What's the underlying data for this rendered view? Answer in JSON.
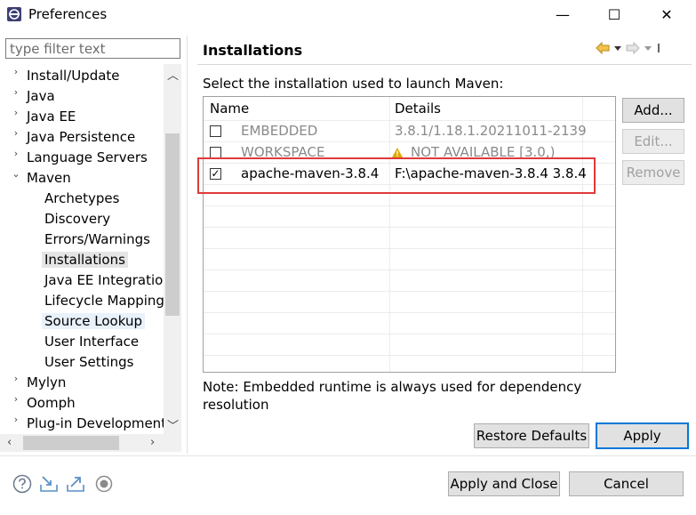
{
  "window": {
    "title": "Preferences",
    "min_glyph": "—",
    "max_glyph": "☐",
    "close_glyph": "✕"
  },
  "filter": {
    "placeholder": "type filter text"
  },
  "tree": {
    "items": [
      {
        "label": "Install/Update",
        "level": 0,
        "expander": "›"
      },
      {
        "label": "Java",
        "level": 0,
        "expander": "›"
      },
      {
        "label": "Java EE",
        "level": 0,
        "expander": "›"
      },
      {
        "label": "Java Persistence",
        "level": 0,
        "expander": "›"
      },
      {
        "label": "Language Servers",
        "level": 0,
        "expander": "›"
      },
      {
        "label": "Maven",
        "level": 0,
        "expander": "⌄"
      },
      {
        "label": "Archetypes",
        "level": 1
      },
      {
        "label": "Discovery",
        "level": 1
      },
      {
        "label": "Errors/Warnings",
        "level": 1
      },
      {
        "label": "Installations",
        "level": 1,
        "selected": true
      },
      {
        "label": "Java EE Integration",
        "level": 1
      },
      {
        "label": "Lifecycle Mapping",
        "level": 1
      },
      {
        "label": "Source Lookup",
        "level": 1,
        "hovered": true
      },
      {
        "label": "User Interface",
        "level": 1
      },
      {
        "label": "User Settings",
        "level": 1
      },
      {
        "label": "Mylyn",
        "level": 0,
        "expander": "›"
      },
      {
        "label": "Oomph",
        "level": 0,
        "expander": "›"
      },
      {
        "label": "Plug-in Development",
        "level": 0,
        "expander": "›"
      }
    ]
  },
  "page": {
    "heading": "Installations",
    "instruction": "Select the installation used to launch Maven:",
    "table": {
      "columns": [
        "Name",
        "Details"
      ],
      "rows": [
        {
          "name": "EMBEDDED",
          "details": "3.8.1/1.18.1.20211011-2139",
          "checked": false,
          "disabled": true,
          "warning": false
        },
        {
          "name": "WORKSPACE",
          "details": "NOT AVAILABLE [3.0,)",
          "checked": false,
          "disabled": true,
          "warning": true
        },
        {
          "name": "apache-maven-3.8.4",
          "details": "F:\\apache-maven-3.8.4 3.8.4",
          "checked": true,
          "disabled": false,
          "warning": false
        }
      ]
    },
    "buttons": {
      "add": "Add...",
      "edit": "Edit...",
      "remove": "Remove"
    },
    "note": "Note: Embedded runtime is always used for dependency resolution",
    "restore_defaults": "Restore Defaults",
    "apply": "Apply"
  },
  "footer": {
    "apply_and_close": "Apply and Close",
    "cancel": "Cancel"
  },
  "colors": {
    "highlight_box": "#e03a3a",
    "accent": "#0078d7",
    "warning": "#e0a800"
  }
}
